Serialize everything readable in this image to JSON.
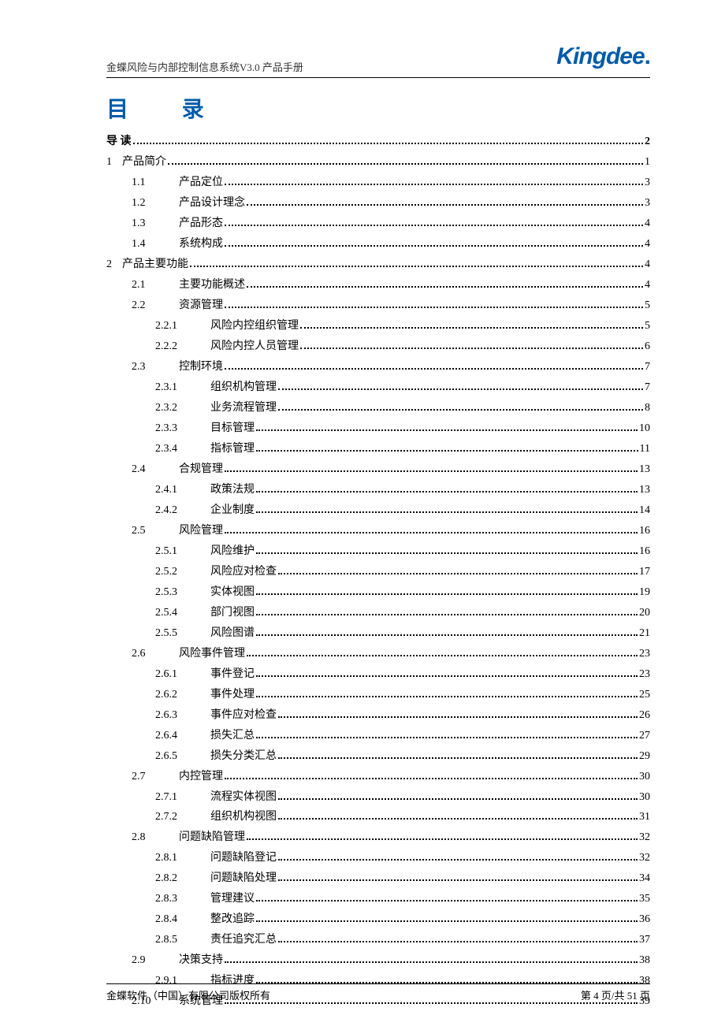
{
  "brand": "Kingdee",
  "header_title": "金蝶风险与内部控制信息系统V3.0 产品手册",
  "toc_title": "目 录",
  "footer_left": "金蝶软件（中国）有限公司版权所有",
  "footer_right": "第 4 页/共 51 页",
  "toc": [
    {
      "level": 0,
      "num": "",
      "sub": "",
      "label": "导 读",
      "page": "2"
    },
    {
      "level": 1,
      "num": "1",
      "sub": "",
      "label": "产品简介",
      "page": "1"
    },
    {
      "level": 2,
      "num": "",
      "sub": "1.1",
      "label": "产品定位",
      "page": "3"
    },
    {
      "level": 2,
      "num": "",
      "sub": "1.2",
      "label": "产品设计理念",
      "page": "3"
    },
    {
      "level": 2,
      "num": "",
      "sub": "1.3",
      "label": "产品形态",
      "page": "4"
    },
    {
      "level": 2,
      "num": "",
      "sub": "1.4",
      "label": "系统构成",
      "page": "4"
    },
    {
      "level": 1,
      "num": "2",
      "sub": "",
      "label": "产品主要功能",
      "page": "4"
    },
    {
      "level": 2,
      "num": "",
      "sub": "2.1",
      "label": "主要功能概述",
      "page": "4"
    },
    {
      "level": 2,
      "num": "",
      "sub": "2.2",
      "label": "资源管理",
      "page": "5"
    },
    {
      "level": 3,
      "num": "",
      "sub": "2.2.1",
      "label": "风险内控组织管理",
      "page": "5"
    },
    {
      "level": 3,
      "num": "",
      "sub": "2.2.2",
      "label": "风险内控人员管理",
      "page": "6"
    },
    {
      "level": 2,
      "num": "",
      "sub": "2.3",
      "label": "控制环境",
      "page": "7"
    },
    {
      "level": 3,
      "num": "",
      "sub": "2.3.1",
      "label": "组织机构管理",
      "page": "7"
    },
    {
      "level": 3,
      "num": "",
      "sub": "2.3.2",
      "label": "业务流程管理",
      "page": "8"
    },
    {
      "level": 3,
      "num": "",
      "sub": "2.3.3",
      "label": "目标管理",
      "page": "10"
    },
    {
      "level": 3,
      "num": "",
      "sub": "2.3.4",
      "label": "指标管理",
      "page": "11"
    },
    {
      "level": 2,
      "num": "",
      "sub": "2.4",
      "label": "合规管理",
      "page": "13"
    },
    {
      "level": 3,
      "num": "",
      "sub": "2.4.1",
      "label": "政策法规",
      "page": "13"
    },
    {
      "level": 3,
      "num": "",
      "sub": "2.4.2",
      "label": "企业制度",
      "page": "14"
    },
    {
      "level": 2,
      "num": "",
      "sub": "2.5",
      "label": "风险管理",
      "page": "16"
    },
    {
      "level": 3,
      "num": "",
      "sub": "2.5.1",
      "label": "风险维护",
      "page": "16"
    },
    {
      "level": 3,
      "num": "",
      "sub": "2.5.2",
      "label": "风险应对检查",
      "page": "17"
    },
    {
      "level": 3,
      "num": "",
      "sub": "2.5.3",
      "label": "实体视图",
      "page": "19"
    },
    {
      "level": 3,
      "num": "",
      "sub": "2.5.4",
      "label": "部门视图",
      "page": "20"
    },
    {
      "level": 3,
      "num": "",
      "sub": "2.5.5",
      "label": "风险图谱",
      "page": "21"
    },
    {
      "level": 2,
      "num": "",
      "sub": "2.6",
      "label": "风险事件管理",
      "page": "23"
    },
    {
      "level": 3,
      "num": "",
      "sub": "2.6.1",
      "label": "事件登记",
      "page": "23"
    },
    {
      "level": 3,
      "num": "",
      "sub": "2.6.2",
      "label": "事件处理",
      "page": "25"
    },
    {
      "level": 3,
      "num": "",
      "sub": "2.6.3",
      "label": "事件应对检查",
      "page": "26"
    },
    {
      "level": 3,
      "num": "",
      "sub": "2.6.4",
      "label": "损失汇总",
      "page": "27"
    },
    {
      "level": 3,
      "num": "",
      "sub": "2.6.5",
      "label": "损失分类汇总",
      "page": "29"
    },
    {
      "level": 2,
      "num": "",
      "sub": "2.7",
      "label": "内控管理",
      "page": "30"
    },
    {
      "level": 3,
      "num": "",
      "sub": "2.7.1",
      "label": "流程实体视图",
      "page": "30"
    },
    {
      "level": 3,
      "num": "",
      "sub": "2.7.2",
      "label": "组织机构视图",
      "page": "31"
    },
    {
      "level": 2,
      "num": "",
      "sub": "2.8",
      "label": "问题缺陷管理",
      "page": "32"
    },
    {
      "level": 3,
      "num": "",
      "sub": "2.8.1",
      "label": "问题缺陷登记",
      "page": "32"
    },
    {
      "level": 3,
      "num": "",
      "sub": "2.8.2",
      "label": "问题缺陷处理",
      "page": "34"
    },
    {
      "level": 3,
      "num": "",
      "sub": "2.8.3",
      "label": "管理建议",
      "page": "35"
    },
    {
      "level": 3,
      "num": "",
      "sub": "2.8.4",
      "label": "整改追踪",
      "page": "36"
    },
    {
      "level": 3,
      "num": "",
      "sub": "2.8.5",
      "label": "责任追究汇总",
      "page": "37"
    },
    {
      "level": 2,
      "num": "",
      "sub": "2.9",
      "label": "决策支持",
      "page": "38"
    },
    {
      "level": 3,
      "num": "",
      "sub": "2.9.1",
      "label": "指标进度",
      "page": "38"
    },
    {
      "level": 2,
      "num": "",
      "sub": "2.10",
      "label": "系统管理",
      "page": "39"
    }
  ]
}
